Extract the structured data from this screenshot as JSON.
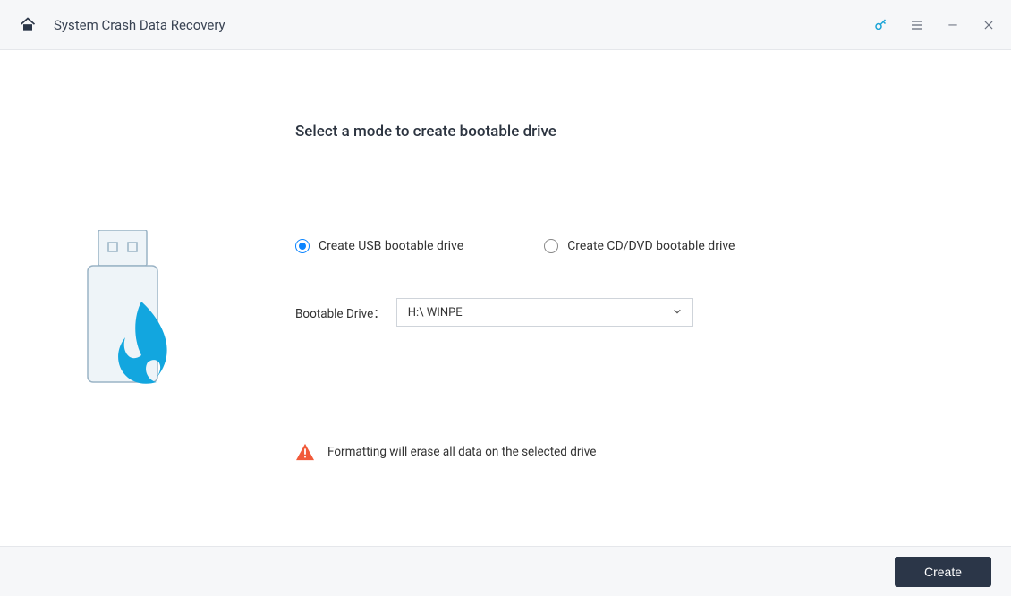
{
  "titlebar": {
    "title": "System Crash Data Recovery"
  },
  "main": {
    "heading": "Select a mode to create bootable drive",
    "option_usb": "Create USB bootable drive",
    "option_cddvd": "Create CD/DVD bootable drive",
    "drive_label": "Bootable Drive：",
    "drive_value": "H:\\ WINPE",
    "warning": "Formatting will erase all data on the selected drive"
  },
  "footer": {
    "create_label": "Create"
  }
}
